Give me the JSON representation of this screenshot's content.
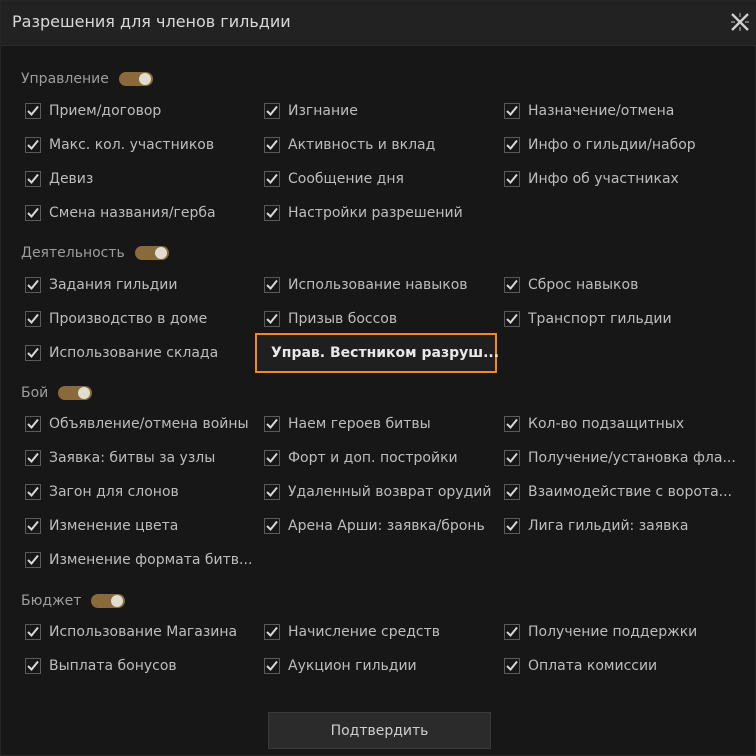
{
  "window": {
    "title": "Разрешения для членов гильдии"
  },
  "sections": {
    "management": {
      "label": "Управление",
      "items": [
        "Прием/договор",
        "Изгнание",
        "Назначение/отмена",
        "Макс. кол. участников",
        "Активность и вклад",
        "Инфо о гильдии/набор",
        "Девиз",
        "Сообщение дня",
        "Инфо об участниках",
        "Смена названия/герба",
        "Настройки разрешений"
      ]
    },
    "activity": {
      "label": "Деятельность",
      "items": [
        "Задания гильдии",
        "Использование навыков",
        "Сброс навыков",
        "Производство в доме",
        "Призыв боссов",
        "Транспорт гильдии",
        "Использование склада",
        "Управ. Вестником разруш..."
      ]
    },
    "battle": {
      "label": "Бой",
      "items": [
        "Объявление/отмена войны",
        "Наем героев битвы",
        "Кол-во подзащитных",
        "Заявка: битвы за узлы",
        "Форт и доп. постройки",
        "Получение/установка фла...",
        "Загон для слонов",
        "Удаленный возврат орудий",
        "Взаимодействие с ворота...",
        "Изменение цвета",
        "Арена Арши: заявка/бронь",
        "Лига гильдий: заявка",
        "Изменение формата битв..."
      ]
    },
    "budget": {
      "label": "Бюджет",
      "items": [
        "Использование Магазина",
        "Начисление средств",
        "Получение поддержки",
        "Выплата бонусов",
        "Аукцион гильдии",
        "Оплата комиссии"
      ]
    }
  },
  "footer": {
    "confirm_label": "Подтвердить"
  },
  "colors": {
    "accent": "#ef8b20",
    "toggle_on": "#8a6a3a",
    "background": "#171717"
  },
  "icons": {
    "close": "close-icon",
    "check": "checkmark-icon"
  }
}
